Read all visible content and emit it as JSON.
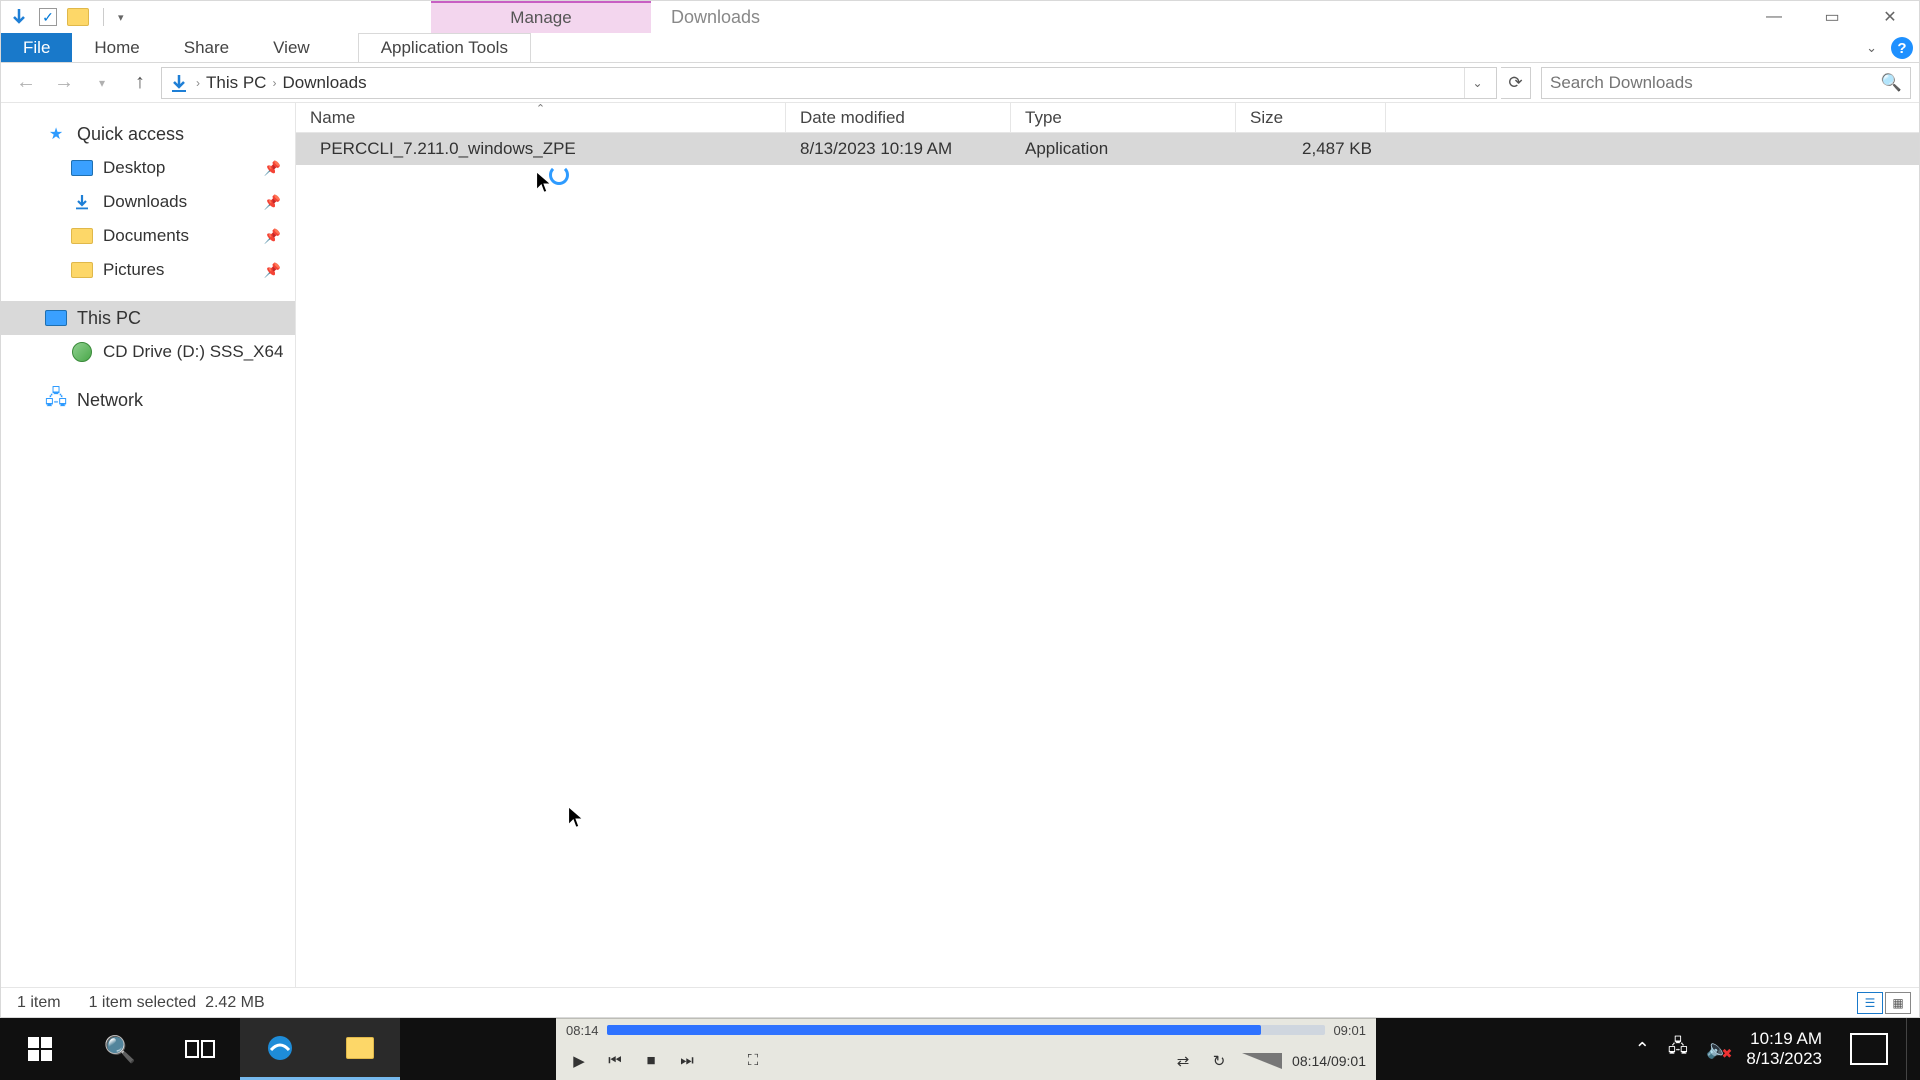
{
  "title": "Downloads",
  "context_tab": "Manage",
  "ribbon": {
    "file": "File",
    "home": "Home",
    "share": "Share",
    "view": "View",
    "context": "Application Tools"
  },
  "breadcrumb": {
    "root": "This PC",
    "folder": "Downloads"
  },
  "search": {
    "placeholder": "Search Downloads"
  },
  "nav": {
    "quick_access": "Quick access",
    "desktop": "Desktop",
    "downloads": "Downloads",
    "documents": "Documents",
    "pictures": "Pictures",
    "this_pc": "This PC",
    "cd_drive": "CD Drive (D:) SSS_X64",
    "network": "Network"
  },
  "columns": {
    "name": "Name",
    "date": "Date modified",
    "type": "Type",
    "size": "Size"
  },
  "files": [
    {
      "name": "PERCCLI_7.211.0_windows_ZPE",
      "date": "8/13/2023 10:19 AM",
      "type": "Application",
      "size": "2,487 KB"
    }
  ],
  "status": {
    "count": "1 item",
    "selection": "1 item selected",
    "sel_size": "2.42 MB"
  },
  "player": {
    "elapsed": "08:14",
    "total": "09:01",
    "timecode": "08:14/09:01"
  },
  "tray": {
    "time": "10:19 AM",
    "date": "8/13/2023"
  }
}
